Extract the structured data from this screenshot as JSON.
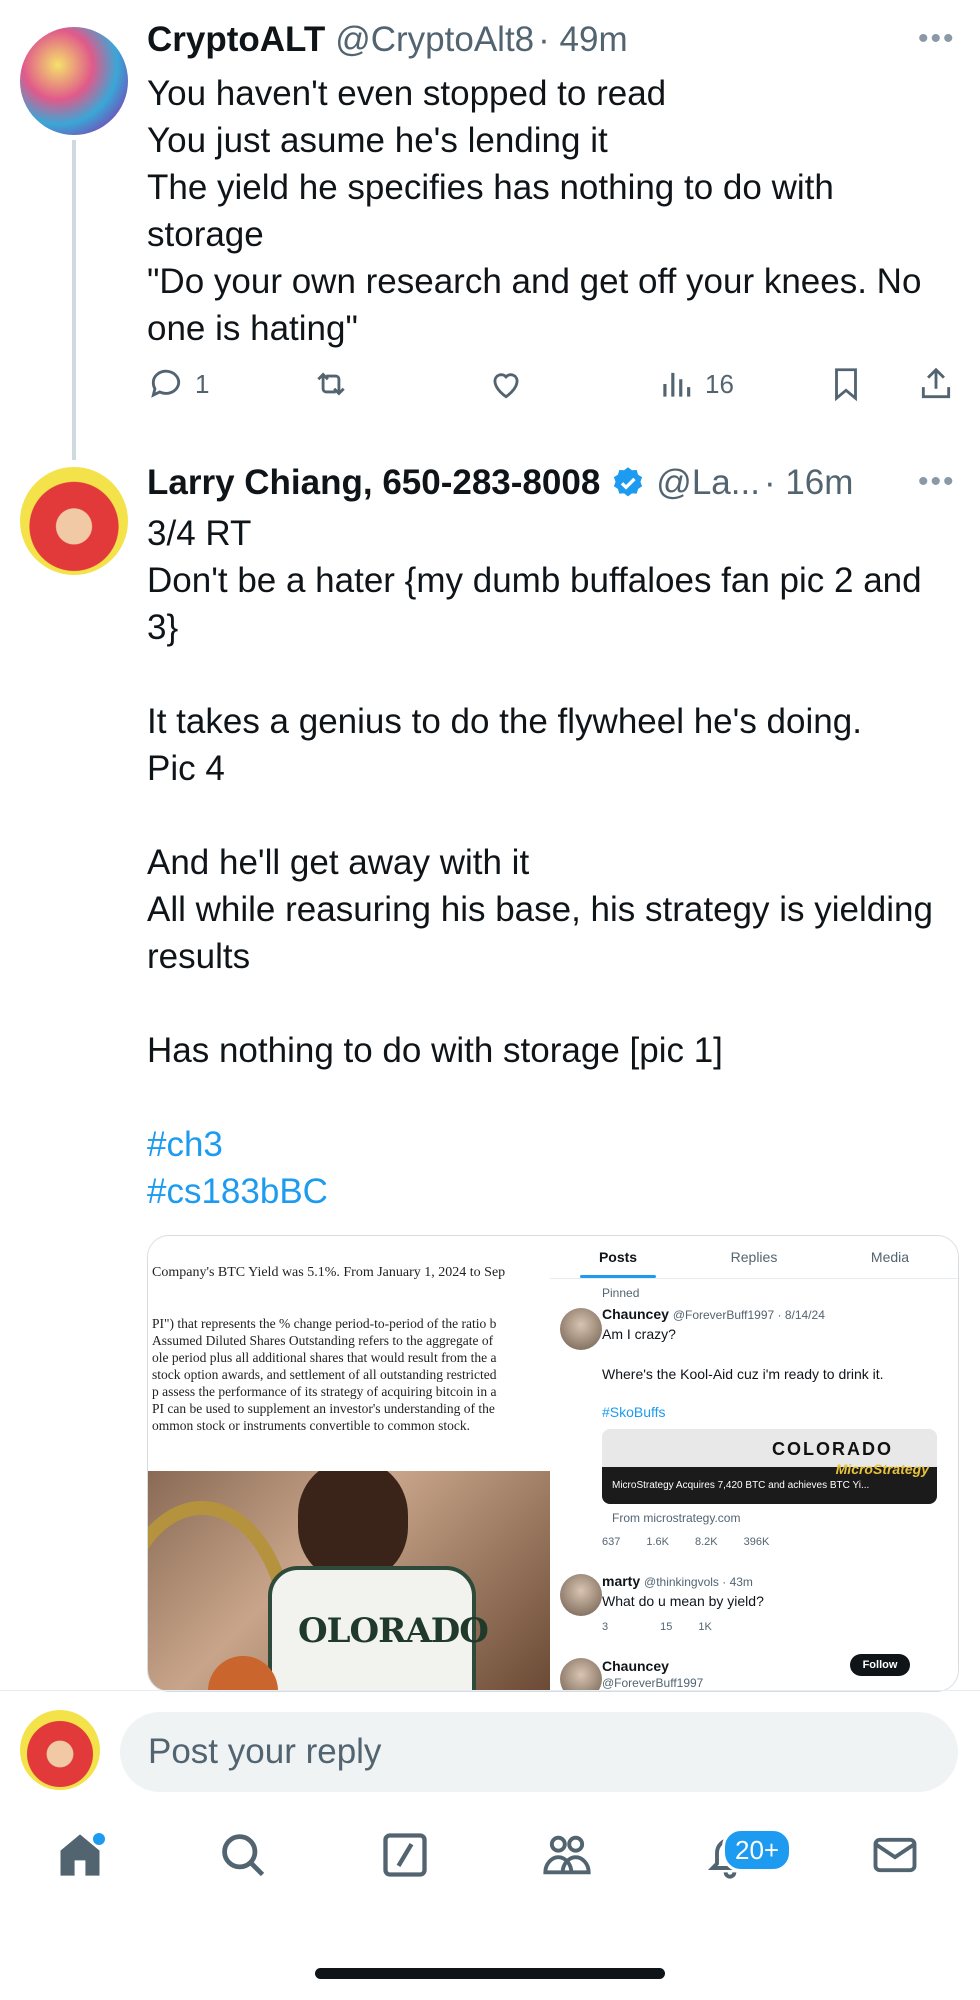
{
  "tweet1": {
    "name": "CryptoALT",
    "handle": "@CryptoAlt8",
    "time": "· 49m",
    "lines": [
      "You haven't even stopped to read",
      "You just asume he's lending it",
      "The yield he specifies has nothing to do with storage",
      "\"Do your own research and get off your knees. No one is hating\""
    ],
    "replies": "1",
    "retweets": "",
    "likes": "",
    "views": "16"
  },
  "tweet2": {
    "name": "Larry Chiang, 650-283-8008",
    "handle": "@La...",
    "time": "· 16m",
    "body": "3/4 RT\nDon't be a hater {my dumb buffaloes fan pic 2 and 3}\n\nIt takes a genius to do the flywheel he's doing.\nPic 4\n\nAnd he'll get away with it\nAll while reasuring his base, his strategy is yielding results\n\nHas nothing to do with storage [pic 1]",
    "hashtags": [
      "#ch3",
      "#cs183bBC"
    ]
  },
  "media": {
    "doc_lines": [
      "Company's BTC Yield was 5.1%. From January 1, 2024 to Sep",
      "",
      "PI\") that represents the % change period-to-period of the ratio b",
      "Assumed Diluted Shares Outstanding refers to the aggregate of",
      "ole period plus all additional shares that would result from the a",
      "stock option awards, and settlement of all outstanding restricted",
      "p assess the performance of its strategy of acquiring bitcoin in a",
      "PI can be used to supplement an investor's understanding of the",
      "ommon stock or instruments convertible to common stock."
    ],
    "jersey_text": "OLORADO",
    "shot": {
      "tabs": [
        "Posts",
        "Replies",
        "Media"
      ],
      "pinned": "Pinned",
      "post1_name": "Chauncey",
      "post1_handle": "@ForeverBuff1997 · 8/14/24",
      "post1_line1": "Am I crazy?",
      "post1_line2": "Where's the Kool-Aid cuz i'm ready to drink it.",
      "post1_tag": "#SkoBuffs",
      "card_logo": "COLORADO",
      "card_brand": "MicroStrategy",
      "card_title": "MicroStrategy Acquires 7,420 BTC and achieves BTC Yi...",
      "card_source": "From microstrategy.com",
      "post1_stats": [
        "637",
        "1.6K",
        "8.2K",
        "396K"
      ],
      "post2_name": "marty",
      "post2_handle": "@thinkingvols · 43m",
      "post2_text": "What do u mean by yield?",
      "post2_stats": [
        "3",
        "",
        "15",
        "1K"
      ],
      "post3_name": "Chauncey",
      "post3_handle": "@ForeverBuff1997",
      "follow_label": "Follow"
    }
  },
  "composer": {
    "placeholder": "Post your reply"
  },
  "nav": {
    "notifications_badge": "20+"
  },
  "colors": {
    "accent": "#1d9bf0",
    "text": "#0f1419",
    "muted": "#536471",
    "line": "#cfd9de"
  }
}
